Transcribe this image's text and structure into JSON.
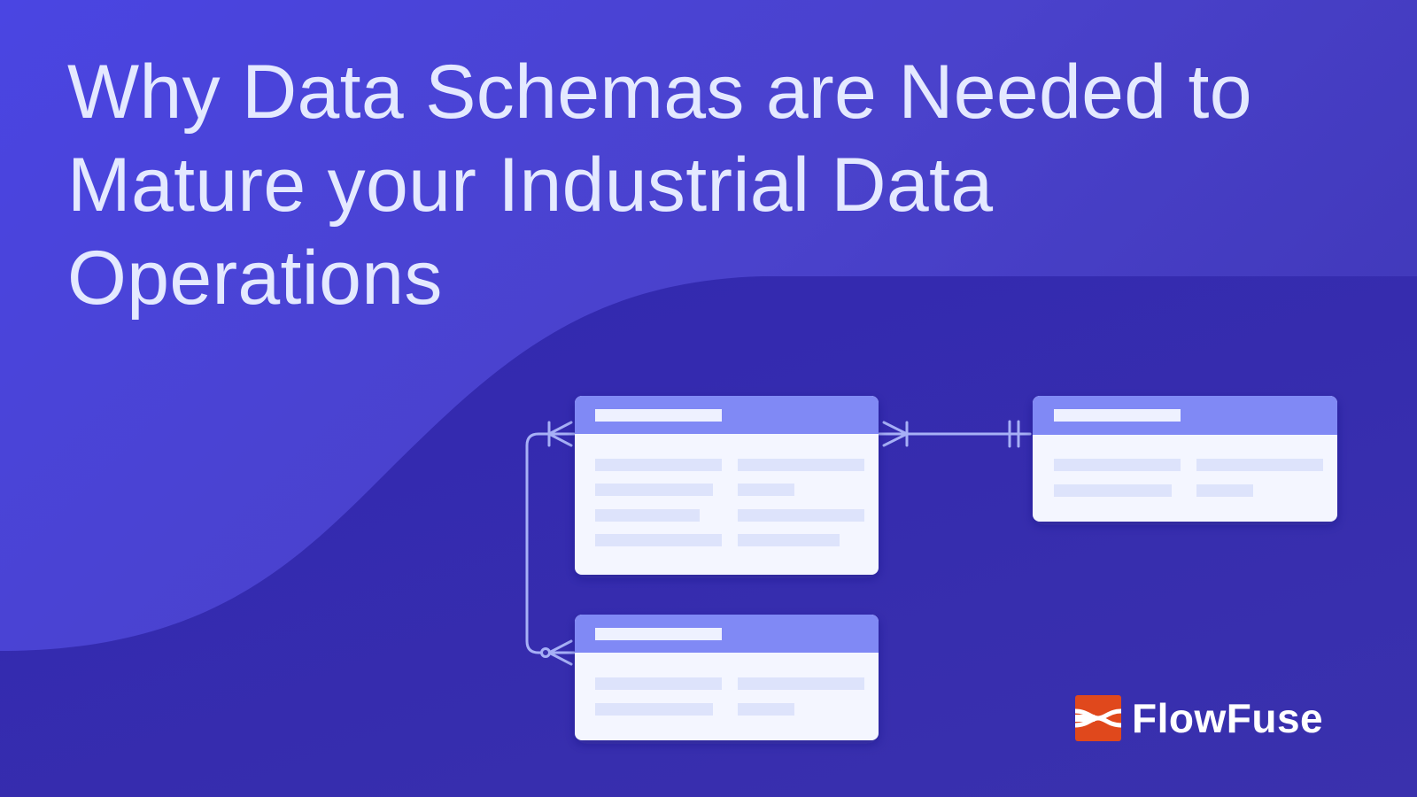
{
  "title": {
    "lines": [
      "Why Data Schemas are Needed to",
      "Mature your Industrial Data",
      "Operations"
    ]
  },
  "brand": {
    "name": "FlowFuse",
    "icon": "flowfuse-logo-icon",
    "mark_color": "#e0481c"
  },
  "colors": {
    "background": "#4a42cc",
    "background_dark": "#3329b0",
    "title_text": "#e4e9ff",
    "table_header": "#8089f5",
    "table_body": "#f4f6ff",
    "placeholder_bar": "#dde3fb",
    "connector": "#a7b0f6"
  },
  "diagram": {
    "tables": [
      {
        "id": "table-main",
        "field_rows": 4
      },
      {
        "id": "table-right",
        "field_rows": 2
      },
      {
        "id": "table-bottom",
        "field_rows": 2
      }
    ],
    "relationships": [
      {
        "from": "table-main",
        "to": "table-right",
        "from_end": "one-or-many",
        "to_end": "exactly-one"
      },
      {
        "from": "table-main",
        "to": "table-bottom",
        "from_end": "one-or-many",
        "to_end": "zero-or-many"
      }
    ]
  }
}
